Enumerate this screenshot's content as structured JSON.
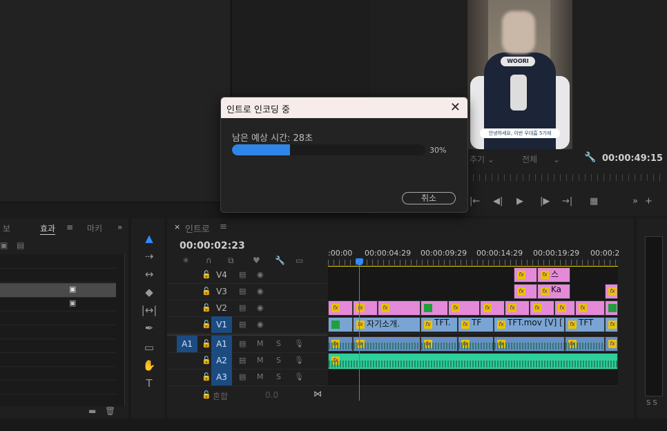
{
  "program": {
    "timecode": "00:00:49:15",
    "dropdown1": "추기",
    "dropdown2": "전체",
    "subtitle": "안녕하세요, 이번 우대흠 5기에",
    "cap_label": "WOORI"
  },
  "effects_panel": {
    "tab_prev": "보",
    "tab_active": "효과",
    "tab_next": "마키"
  },
  "timeline": {
    "tab_label": "인트로",
    "timecode": "00:00:02:23",
    "ruler_labels": [
      ":00:00",
      "00:00:04:29",
      "00:00:09:29",
      "00:00:14:29",
      "00:00:19:29",
      "00:00:2"
    ],
    "tracks": {
      "v4": "V4",
      "v3": "V3",
      "v2": "V2",
      "v1": "V1",
      "a1_src": "A1",
      "a1": "A1",
      "a2": "A2",
      "a3": "A3",
      "mix_label": "혼합",
      "mix_value": "0.0"
    },
    "clips_v1": [
      "자기소개.",
      "TFT.",
      "TF",
      "TFT.mov [V] [",
      "TFT"
    ],
    "clips_v3": [
      "Ka"
    ],
    "clips_v4": [
      "스"
    ]
  },
  "dialog": {
    "title": "인트로 인코딩 중",
    "remaining": "남은 예상 시간: 28초",
    "progress_percent": 30,
    "progress_label": "30%",
    "cancel_label": "취소",
    "colors": {
      "progress": "#2f86e8"
    }
  },
  "meter": {
    "solo_left": "S",
    "solo_right": "S"
  }
}
